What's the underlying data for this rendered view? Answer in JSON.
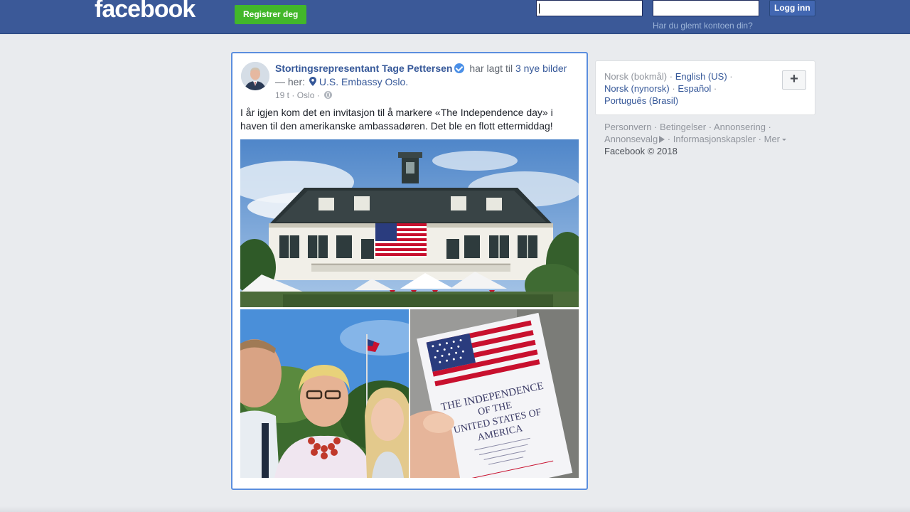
{
  "header": {
    "logo": "facebook",
    "register_label": "Registrer deg",
    "login_label": "Logg inn",
    "forgot_label": "Har du glemt kontoen din?",
    "email_value": "",
    "password_value": ""
  },
  "post": {
    "author": "Stortingsrepresentant Tage Pettersen",
    "action_text": " har lagt til ",
    "photos_link": "3 nye bilder",
    "here_text": " — her: ",
    "location": "U.S. Embassy Oslo.",
    "time": "19 t",
    "sep1": " · ",
    "place": "Oslo",
    "sep2": " · ",
    "text": "I år igjen kom det en invitasjon til å markere «The Independence day» i haven til den amerikanske ambassadøren. Det ble en flott ettermiddag!",
    "photos": [
      {
        "icon": "embassy-building-photo"
      },
      {
        "icon": "selfie-photo"
      },
      {
        "icon": "invitation-card-photo"
      }
    ],
    "card_text": {
      "line1": "THE INDEPENDENCE",
      "line2": "OF THE",
      "line3": "UNITED STATES OF",
      "line4": "AMERICA"
    }
  },
  "languages": {
    "current": "Norsk (bokmål)",
    "items": [
      "English (US)",
      "Norsk (nynorsk)",
      "Español",
      "Português (Brasil)"
    ],
    "add_icon": "+"
  },
  "footer": {
    "links": [
      "Personvern",
      "Betingelser",
      "Annonsering",
      "Annonsevalg",
      "Informasjonskapsler",
      "Mer"
    ],
    "copyright": "Facebook © 2018"
  },
  "colors": {
    "brand_blue": "#3b5998",
    "link_blue": "#365899",
    "register_green": "#42b72a",
    "focus_border": "#5b8ede"
  }
}
